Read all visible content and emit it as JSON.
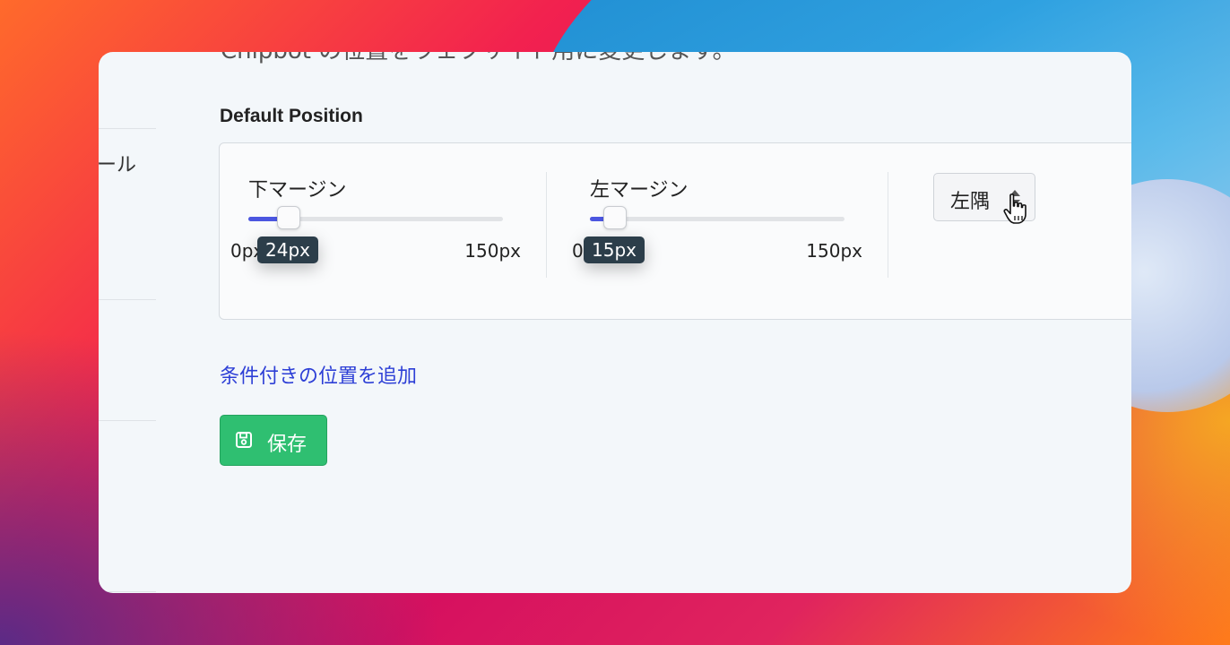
{
  "sidebar": {
    "partial_text": "ール"
  },
  "header": {
    "clipped_description": "Chipbot の位置をウェブサイト用に変更します。"
  },
  "section": {
    "title": "Default Position"
  },
  "bottom_margin": {
    "label": "下マージン",
    "min_label": "0px",
    "max_label": "150px",
    "min": 0,
    "max": 150,
    "value": 24,
    "tooltip": "24px"
  },
  "left_margin": {
    "label": "左マージン",
    "min_label": "0px",
    "max_label": "150px",
    "min": 0,
    "max": 150,
    "value": 15,
    "tooltip": "15px"
  },
  "corner_select": {
    "value": "左隅"
  },
  "actions": {
    "add_conditional_position": "条件付きの位置を追加",
    "save_label": "保存"
  },
  "colors": {
    "accent": "#4b56e0",
    "link": "#2d3fd6",
    "save_button": "#2fbf71",
    "tooltip_bg": "#2c3e4a"
  },
  "icons": {
    "save": "floppy-disk-icon",
    "select_arrows": "sort-arrows-icon",
    "cursor": "hand-pointer-icon"
  }
}
